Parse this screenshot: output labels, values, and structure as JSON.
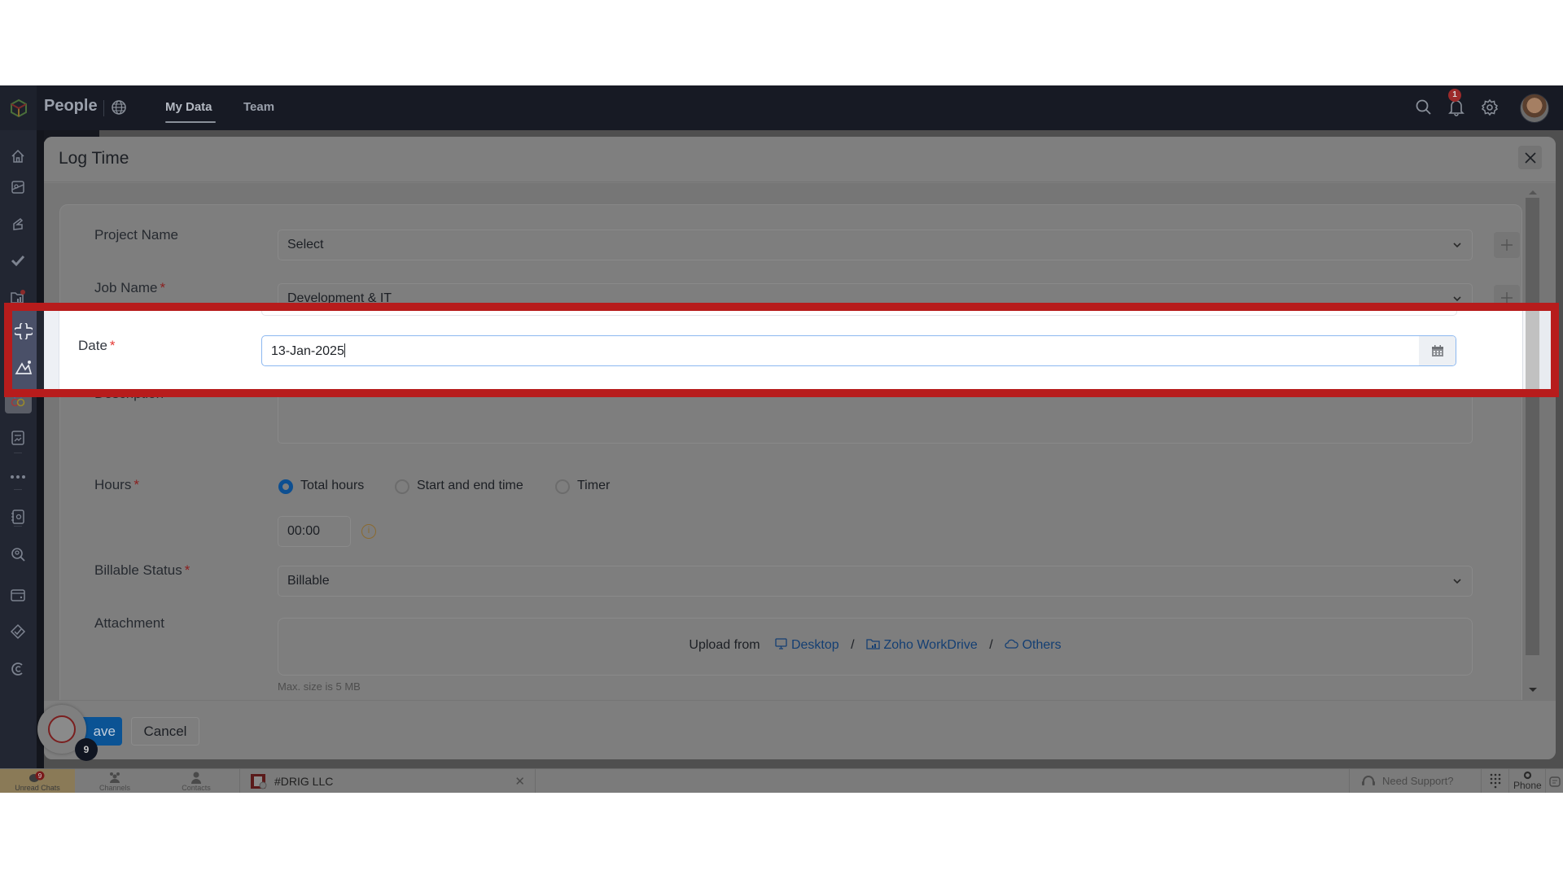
{
  "header": {
    "app_title": "People",
    "tabs": [
      {
        "label": "My Data",
        "active": true
      },
      {
        "label": "Team",
        "active": false
      }
    ],
    "notification_count": "1",
    "icons": [
      "search-icon",
      "bell-icon",
      "gear-icon",
      "avatar"
    ]
  },
  "sidebar": {
    "items": [
      {
        "name": "home-icon"
      },
      {
        "name": "profile-card-icon"
      },
      {
        "name": "leave-icon"
      },
      {
        "name": "approvals-check-icon"
      },
      {
        "name": "folder-chart-icon",
        "has_badge": true
      },
      {
        "name": "timesheet-icon",
        "highlighted": true
      },
      {
        "name": "performance-icon",
        "highlighted": true
      },
      {
        "name": "feedback-chat-icon"
      },
      {
        "name": "apps-icon",
        "active": true
      },
      {
        "name": "forms-icon"
      },
      {
        "name": "more-icon"
      },
      {
        "name": "contacts-book-icon"
      },
      {
        "name": "search-people-icon"
      },
      {
        "name": "wallet-icon"
      },
      {
        "name": "tasks-icon"
      },
      {
        "name": "cases-icon"
      }
    ]
  },
  "modal": {
    "title": "Log Time",
    "fields": {
      "project_name": {
        "label": "Project Name",
        "required": false,
        "value": "Select"
      },
      "job_name": {
        "label": "Job Name",
        "required": true,
        "value": "Development & IT"
      },
      "date": {
        "label": "Date",
        "required": true,
        "value": "13-Jan-2025"
      },
      "description": {
        "label": "Description",
        "required": false,
        "value": ""
      },
      "hours": {
        "label": "Hours",
        "required": true,
        "options": [
          "Total hours",
          "Start and end time",
          "Timer"
        ],
        "selected": "Total hours",
        "value": "00:00"
      },
      "billable_status": {
        "label": "Billable Status",
        "required": true,
        "value": "Billable"
      },
      "attachment": {
        "label": "Attachment",
        "upload_prefix": "Upload from",
        "sources": [
          "Desktop",
          "Zoho WorkDrive",
          "Others"
        ],
        "hint": "Max. size is 5 MB"
      }
    },
    "required_mark": "*",
    "buttons": {
      "save": "Save",
      "save_visible": "ave",
      "cancel": "Cancel"
    }
  },
  "chat_widget": {
    "unread_count": "9"
  },
  "bottom_bar": {
    "unread_chats": {
      "label": "Unread Chats",
      "badge": "9"
    },
    "channels": "Channels",
    "contacts": "Contacts",
    "open_chat": "#DRIG LLC",
    "need_support": "Need Support?",
    "phone": "Phone"
  },
  "highlight": {
    "target": "date-field",
    "color": "#b71c1c"
  },
  "colors": {
    "accent_blue": "#0b5394",
    "required_red": "#e53935",
    "header_bg": "#171a24"
  }
}
